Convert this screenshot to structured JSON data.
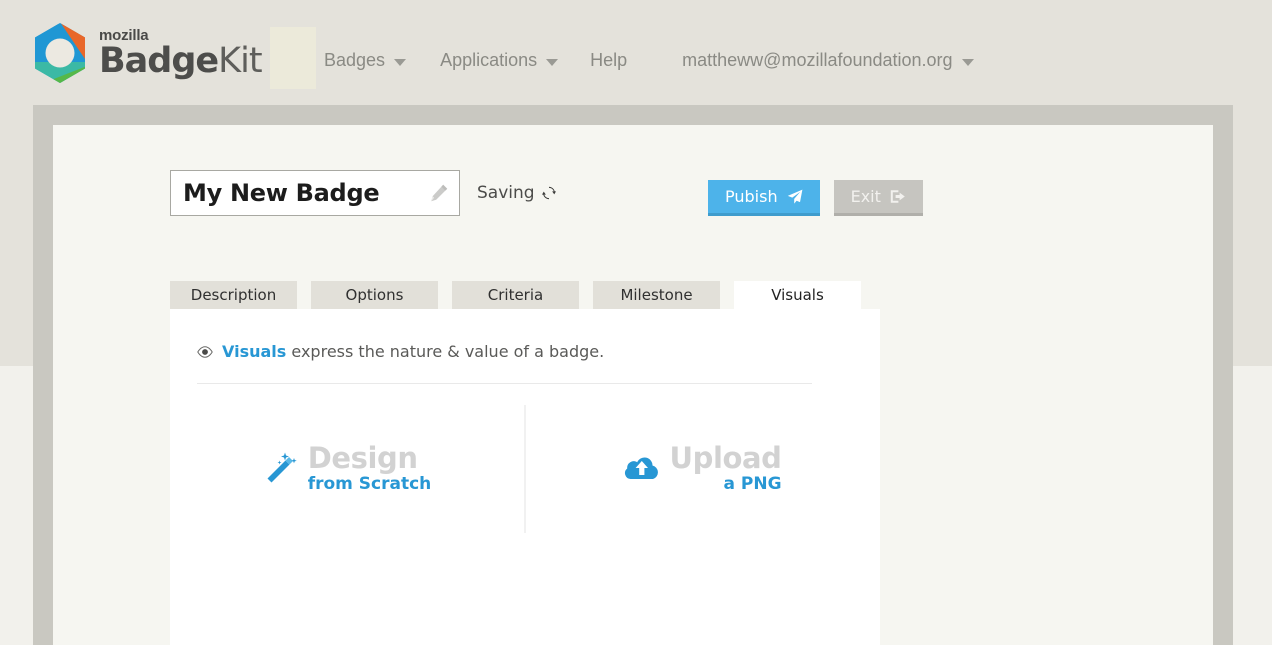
{
  "brand": {
    "mozilla": "mozilla",
    "name_bold": "Badge",
    "name_light": "Kit",
    "logo_colors": {
      "orange": "#e8672a",
      "blue": "#1f97d4",
      "teal": "#3bb9a5",
      "green": "#56b848"
    }
  },
  "nav": {
    "items": [
      {
        "label": "Badges",
        "has_caret": true
      },
      {
        "label": "Applications",
        "has_caret": true
      },
      {
        "label": "Help",
        "has_caret": false
      },
      {
        "label": "mattheww@mozillafoundation.org",
        "has_caret": true
      }
    ]
  },
  "badge": {
    "title": "My New Badge",
    "title_placeholder": "Badge name",
    "edit_icon": "pencil-icon",
    "status": "Saving",
    "status_icon": "refresh-icon"
  },
  "actions": {
    "publish_label": "Pubish",
    "publish_icon": "paper-plane-icon",
    "publish_color": "#4db3ea",
    "exit_label": "Exit",
    "exit_icon": "sign-out-icon",
    "exit_color": "#c6c5c0"
  },
  "tabs": [
    {
      "label": "Description",
      "active": false
    },
    {
      "label": "Options",
      "active": false
    },
    {
      "label": "Criteria",
      "active": false
    },
    {
      "label": "Milestone",
      "active": false
    },
    {
      "label": "Visuals",
      "active": true
    }
  ],
  "visuals": {
    "icon": "eye-icon",
    "intro_strong": "Visuals",
    "intro_rest": " express the nature & value of a badge.",
    "accent_color": "#2897d4",
    "choices": [
      {
        "icon": "magic-wand-icon",
        "main": "Design",
        "sub": "from Scratch"
      },
      {
        "icon": "cloud-upload-icon",
        "main": "Upload",
        "sub": "a PNG"
      }
    ]
  }
}
